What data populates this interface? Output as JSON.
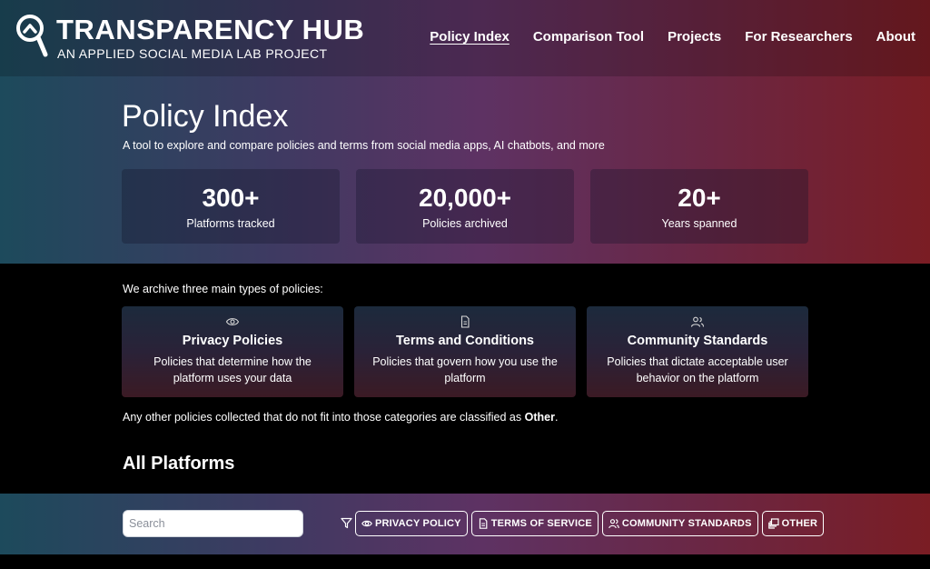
{
  "brand": {
    "title": "TRANSPARENCY HUB",
    "subtitle": "AN APPLIED SOCIAL MEDIA LAB PROJECT",
    "logo_icon": "magnifier-icon"
  },
  "nav": {
    "items": [
      {
        "label": "Policy Index",
        "active": true
      },
      {
        "label": "Comparison Tool",
        "active": false
      },
      {
        "label": "Projects",
        "active": false
      },
      {
        "label": "For Researchers",
        "active": false
      },
      {
        "label": "About",
        "active": false
      }
    ]
  },
  "hero": {
    "title": "Policy Index",
    "subtitle": "A tool to explore and compare policies and terms from social media apps, AI chatbots, and more",
    "stats": [
      {
        "value": "300+",
        "label": "Platforms tracked"
      },
      {
        "value": "20,000+",
        "label": "Policies archived"
      },
      {
        "value": "20+",
        "label": "Years spanned"
      }
    ]
  },
  "policy_types": {
    "intro": "We archive three main types of policies:",
    "cards": [
      {
        "icon": "eye-icon",
        "title": "Privacy Policies",
        "description": "Policies that determine how the platform uses your data"
      },
      {
        "icon": "document-icon",
        "title": "Terms and Conditions",
        "description": "Policies that govern how you use the platform"
      },
      {
        "icon": "users-icon",
        "title": "Community Standards",
        "description": "Policies that dictate acceptable user behavior on the platform"
      }
    ],
    "other_note_prefix": "Any other policies collected that do not fit into those categories are classified as ",
    "other_note_bold": "Other",
    "other_note_suffix": "."
  },
  "platforms": {
    "title": "All Platforms",
    "search_placeholder": "Search",
    "search_value": "",
    "filter_icon": "filter-icon",
    "filters": [
      {
        "icon": "eye-icon",
        "label": "PRIVACY POLICY"
      },
      {
        "icon": "document-icon",
        "label": "TERMS OF SERVICE"
      },
      {
        "icon": "users-icon",
        "label": "COMMUNITY STANDARDS"
      },
      {
        "icon": "stack-icon",
        "label": "OTHER"
      }
    ]
  },
  "colors": {
    "gradient_left": "#1d4a5c",
    "gradient_mid": "#5e3263",
    "gradient_right": "#7a1d24",
    "background": "#000000"
  }
}
